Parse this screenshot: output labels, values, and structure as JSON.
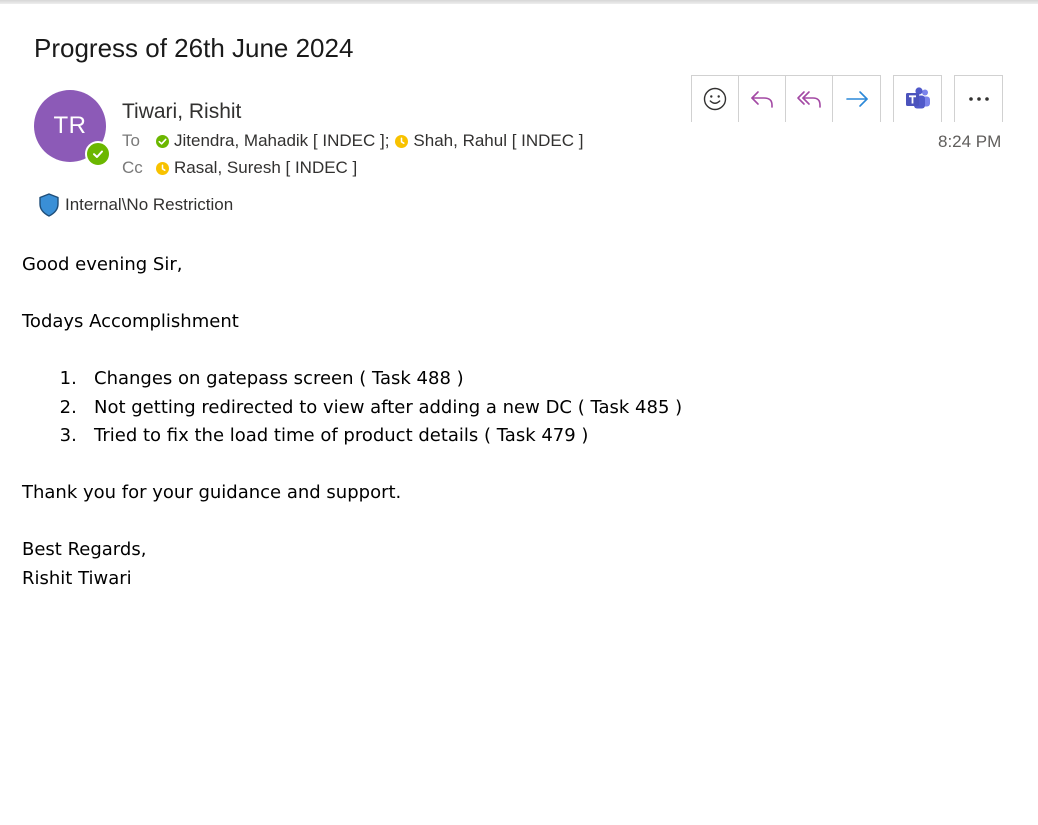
{
  "email": {
    "subject": "Progress of 26th June 2024",
    "sender": {
      "initials": "TR",
      "name": "Tiwari, Rishit",
      "avatar_color": "#8c5ab7",
      "presence": "available"
    },
    "to_label": "To",
    "to": [
      {
        "name": "Jitendra, Mahadik [ INDEC ];",
        "presence": "available"
      },
      {
        "name": "Shah, Rahul [ INDEC ]",
        "presence": "away"
      }
    ],
    "cc_label": "Cc",
    "cc": [
      {
        "name": "Rasal, Suresh [ INDEC ]",
        "presence": "away"
      }
    ],
    "time": "8:24 PM",
    "sensitivity_label": "Internal\\No Restriction",
    "toolbar": {
      "icons": [
        "emoji-icon",
        "reply-icon",
        "reply-all-icon",
        "forward-icon",
        "teams-icon",
        "more-icon"
      ]
    },
    "body": {
      "greeting": "Good evening Sir,",
      "section_title": "Todays Accomplishment",
      "items": [
        "Changes on gatepass screen ( Task 488 )",
        "Not getting redirected to view after adding a new DC ( Task 485 )",
        "Tried to fix the load time of product details ( Task 479 )"
      ],
      "thanks": "Thank you for your guidance and support.",
      "closing": "Best Regards,",
      "signature": "Rishit Tiwari"
    }
  },
  "colors": {
    "accent_purple": "#a349a4",
    "forward_blue": "#2b88d8",
    "available_green": "#6bb700",
    "away_yellow": "#f8c200",
    "shield_blue": "#3a8fd6"
  }
}
